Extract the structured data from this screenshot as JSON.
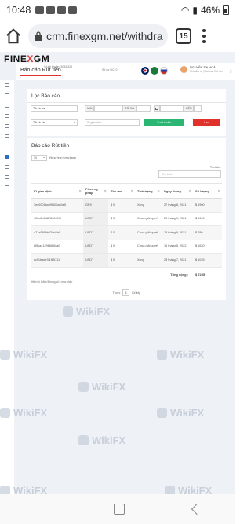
{
  "status_bar": {
    "time": "10:48",
    "battery": "46%"
  },
  "browser": {
    "url": "crm.finexgm.net/withdra",
    "tab_count": "15"
  },
  "site": {
    "logo_a": "FINE",
    "logo_x": "X",
    "logo_b": "GM",
    "page_title": "Báo cáo Rút tiền",
    "account_id": "Số tài khoản: 3034,328",
    "balance": "Số dư ĐC: 0",
    "user_name": "NGUYỄN THỊ HOÀI",
    "user_role": "Nhà đầu tư | Báo cáo Rút tiền"
  },
  "filter": {
    "title": "Lọc Báo cáo",
    "select1": "Tất cả các",
    "select2": "Tất cả các",
    "min_label": "MIN",
    "max_label": "TỐI ĐA",
    "end_label": "ĐẾN",
    "tx_placeholder": "ID giao dịch",
    "search_button": "Xuất khẩu",
    "reset_button": "Lọc"
  },
  "report": {
    "title": "Báo cáo Rút tiền",
    "page_size": "10",
    "page_size_suffix": "Hồ sơ trên từng trang",
    "search_label": "Tìm kiếm:",
    "search_placeholder": "Tìm kiếm",
    "columns": [
      "ID giao dịch",
      "Phương pháp",
      "Thu tao",
      "Tình trạng",
      "Ngày tháng",
      "Số lượng"
    ],
    "rows": [
      {
        "id": "3ec0001ba99f100a84e5",
        "method": "GPX",
        "fee": "$ 0",
        "status": "Xong",
        "date": "27 tháng 8, 2021",
        "amount": "$ 1900"
      },
      {
        "id": "422d0b8d8786069f5",
        "method": "USDT",
        "fee": "$ 0",
        "status": "Chưa giải quyết",
        "date": "20 tháng 9, 2021",
        "amount": "$ 1900"
      },
      {
        "id": "a71a5896b220d4b9",
        "method": "USDT",
        "fee": "$ 0",
        "status": "Chưa giải quyết",
        "date": "13 tháng 9, 2021",
        "amount": "$ 780"
      },
      {
        "id": "8f5ca41296660fca0",
        "method": "USDT",
        "fee": "$ 0",
        "status": "Chưa giải quyết",
        "date": "19 tháng 5, 2022",
        "amount": "$ 1630"
      },
      {
        "id": "cc91bade3f1f85711",
        "method": "USDT",
        "fee": "$ 0",
        "status": "Xong",
        "date": "28 tháng 7, 2021",
        "amount": "$ 1025"
      }
    ],
    "total_label": "Tổng cộng :",
    "total_value": "$ 7235",
    "showing": "Hiển thị 1 đến 5 trong số 5 mục nhập",
    "prev": "Trước",
    "page": "1",
    "next": "Kế tiếp"
  },
  "watermark_text": "WikiFX"
}
